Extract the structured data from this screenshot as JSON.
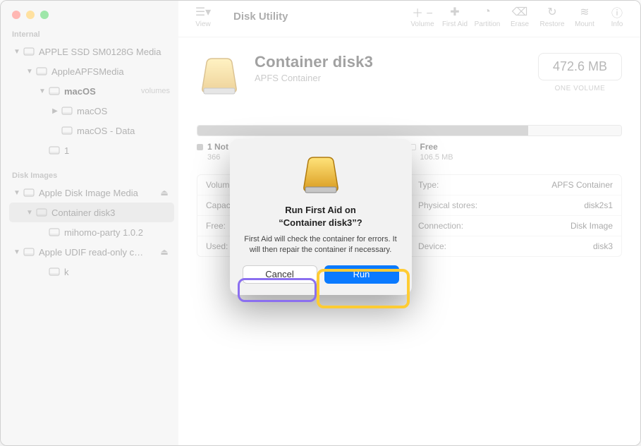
{
  "app": {
    "title": "Disk Utility"
  },
  "toolbar": {
    "view": "View",
    "volume": "Volume",
    "first_aid": "First Aid",
    "partition": "Partition",
    "erase": "Erase",
    "restore": "Restore",
    "mount": "Mount",
    "info": "Info"
  },
  "sidebar": {
    "internal_head": "Internal",
    "images_head": "Disk Images",
    "internal": [
      {
        "label": "APPLE SSD SM0128G Media",
        "indent": 0,
        "chev": "down"
      },
      {
        "label": "AppleAPFSMedia",
        "indent": 1,
        "chev": "down"
      },
      {
        "label": "macOS",
        "indent": 2,
        "chev": "down",
        "strong": true,
        "sub": "volumes"
      },
      {
        "label": "macOS",
        "indent": 3,
        "chev": "right"
      },
      {
        "label": "macOS - Data",
        "indent": 3
      },
      {
        "label": "1",
        "indent": 2
      }
    ],
    "images": [
      {
        "label": "Apple Disk Image Media",
        "indent": 0,
        "chev": "down",
        "eject": true
      },
      {
        "label": "Container disk3",
        "indent": 1,
        "chev": "down",
        "selected": true
      },
      {
        "label": "mihomo-party 1.0.2",
        "indent": 2
      },
      {
        "label": "Apple UDIF read-only c…",
        "indent": 0,
        "chev": "down",
        "eject": true
      },
      {
        "label": "k",
        "indent": 2
      }
    ]
  },
  "header": {
    "title": "Container disk3",
    "subtitle": "APFS Container",
    "size": "472.6 MB",
    "size_caption": "ONE VOLUME"
  },
  "legend": {
    "used_label": "1 Not Mounted",
    "used_value": "366",
    "free_label": "Free",
    "free_value": "106.5 MB"
  },
  "info": {
    "left": [
      {
        "k": "Volumes",
        "v": ""
      },
      {
        "k": "Capacity",
        "v": ""
      },
      {
        "k": "Free:",
        "v": ""
      },
      {
        "k": "Used:",
        "v": ""
      }
    ],
    "right": [
      {
        "k": "Type:",
        "v": "APFS Container"
      },
      {
        "k": "Physical stores:",
        "v": "disk2s1"
      },
      {
        "k": "Connection:",
        "v": "Disk Image"
      },
      {
        "k": "Device:",
        "v": "disk3"
      }
    ]
  },
  "modal": {
    "title_line1": "Run First Aid on",
    "title_line2": "“Container disk3”?",
    "body": "First Aid will check the container for errors. It will then repair the container if necessary.",
    "cancel": "Cancel",
    "run": "Run"
  }
}
